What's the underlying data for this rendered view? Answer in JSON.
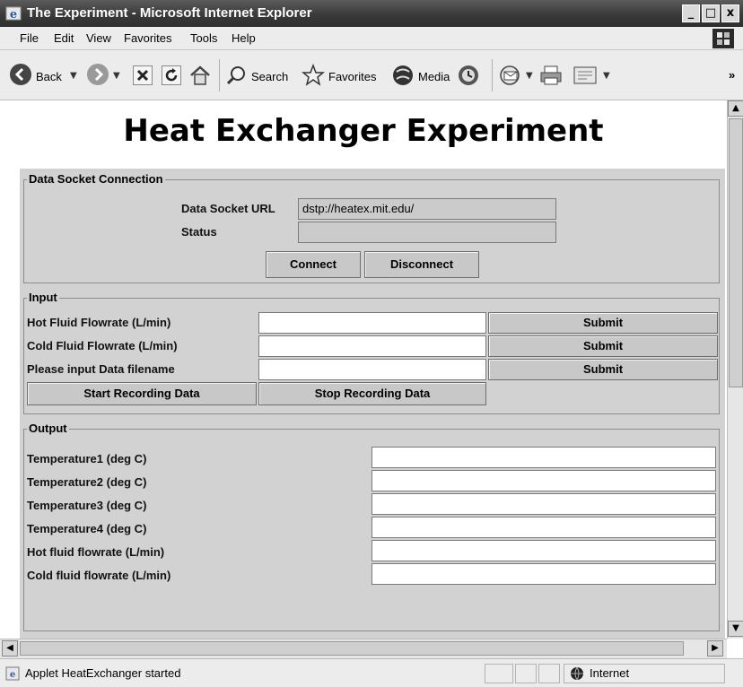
{
  "window": {
    "title": "The Experiment - Microsoft Internet Explorer",
    "min": "_",
    "max": "□",
    "close": "x"
  },
  "menu": [
    "File",
    "Edit",
    "View",
    "Favorites",
    "Tools",
    "Help"
  ],
  "toolbar": {
    "back": "Back",
    "search": "Search",
    "favorites": "Favorites",
    "media": "Media",
    "overflow": "»"
  },
  "page": {
    "title": "Heat Exchanger Experiment"
  },
  "datasocket": {
    "legend": "Data Socket Connection",
    "url_label": "Data Socket URL",
    "url_value": "dstp://heatex.mit.edu/",
    "status_label": "Status",
    "status_value": "",
    "connect": "Connect",
    "disconnect": "Disconnect"
  },
  "input": {
    "legend": "Input",
    "rows": [
      {
        "label": "Hot Fluid Flowrate (L/min)",
        "value": "",
        "submit": "Submit"
      },
      {
        "label": "Cold Fluid Flowrate (L/min)",
        "value": "",
        "submit": "Submit"
      },
      {
        "label": "Please input Data filename",
        "value": "",
        "submit": "Submit"
      }
    ],
    "start_recording": "Start Recording Data",
    "stop_recording": "Stop Recording Data"
  },
  "output": {
    "legend": "Output",
    "rows": [
      {
        "label": "Temperature1 (deg C)",
        "value": ""
      },
      {
        "label": "Temperature2 (deg C)",
        "value": ""
      },
      {
        "label": "Temperature3 (deg C)",
        "value": ""
      },
      {
        "label": "Temperature4 (deg C)",
        "value": ""
      },
      {
        "label": "Hot fluid flowrate (L/min)",
        "value": ""
      },
      {
        "label": "Cold fluid flowrate (L/min)",
        "value": ""
      }
    ]
  },
  "statusbar": {
    "message": "Applet HeatExchanger started",
    "zone": "Internet"
  },
  "icons": [
    "ie-icon",
    "windows-logo-icon",
    "back-arrow-icon",
    "forward-arrow-icon",
    "stop-icon",
    "refresh-icon",
    "home-icon",
    "search-icon",
    "favorites-star-icon",
    "media-icon",
    "history-icon",
    "mail-icon",
    "print-icon",
    "edit-icon",
    "page-icon",
    "globe-icon"
  ]
}
